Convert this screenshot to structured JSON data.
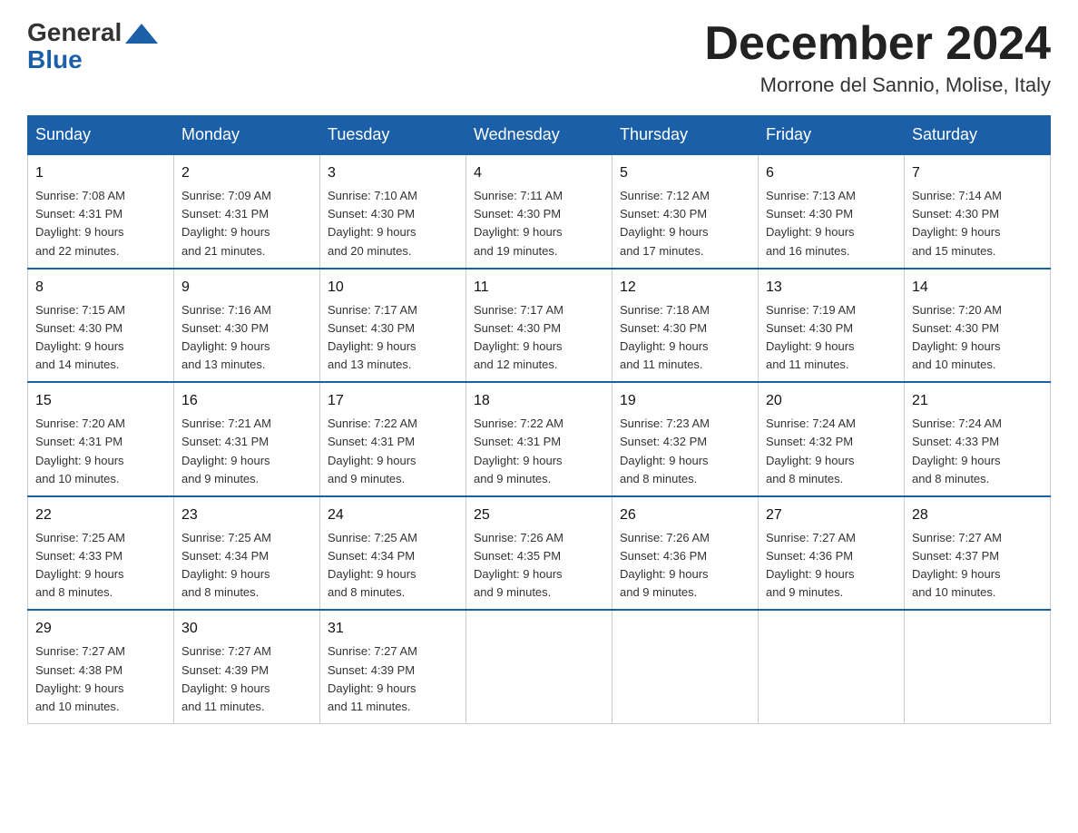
{
  "logo": {
    "general": "General",
    "blue": "Blue"
  },
  "title": "December 2024",
  "location": "Morrone del Sannio, Molise, Italy",
  "headers": [
    "Sunday",
    "Monday",
    "Tuesday",
    "Wednesday",
    "Thursday",
    "Friday",
    "Saturday"
  ],
  "weeks": [
    [
      {
        "day": "1",
        "sunrise": "7:08 AM",
        "sunset": "4:31 PM",
        "daylight": "9 hours and 22 minutes."
      },
      {
        "day": "2",
        "sunrise": "7:09 AM",
        "sunset": "4:31 PM",
        "daylight": "9 hours and 21 minutes."
      },
      {
        "day": "3",
        "sunrise": "7:10 AM",
        "sunset": "4:30 PM",
        "daylight": "9 hours and 20 minutes."
      },
      {
        "day": "4",
        "sunrise": "7:11 AM",
        "sunset": "4:30 PM",
        "daylight": "9 hours and 19 minutes."
      },
      {
        "day": "5",
        "sunrise": "7:12 AM",
        "sunset": "4:30 PM",
        "daylight": "9 hours and 17 minutes."
      },
      {
        "day": "6",
        "sunrise": "7:13 AM",
        "sunset": "4:30 PM",
        "daylight": "9 hours and 16 minutes."
      },
      {
        "day": "7",
        "sunrise": "7:14 AM",
        "sunset": "4:30 PM",
        "daylight": "9 hours and 15 minutes."
      }
    ],
    [
      {
        "day": "8",
        "sunrise": "7:15 AM",
        "sunset": "4:30 PM",
        "daylight": "9 hours and 14 minutes."
      },
      {
        "day": "9",
        "sunrise": "7:16 AM",
        "sunset": "4:30 PM",
        "daylight": "9 hours and 13 minutes."
      },
      {
        "day": "10",
        "sunrise": "7:17 AM",
        "sunset": "4:30 PM",
        "daylight": "9 hours and 13 minutes."
      },
      {
        "day": "11",
        "sunrise": "7:17 AM",
        "sunset": "4:30 PM",
        "daylight": "9 hours and 12 minutes."
      },
      {
        "day": "12",
        "sunrise": "7:18 AM",
        "sunset": "4:30 PM",
        "daylight": "9 hours and 11 minutes."
      },
      {
        "day": "13",
        "sunrise": "7:19 AM",
        "sunset": "4:30 PM",
        "daylight": "9 hours and 11 minutes."
      },
      {
        "day": "14",
        "sunrise": "7:20 AM",
        "sunset": "4:30 PM",
        "daylight": "9 hours and 10 minutes."
      }
    ],
    [
      {
        "day": "15",
        "sunrise": "7:20 AM",
        "sunset": "4:31 PM",
        "daylight": "9 hours and 10 minutes."
      },
      {
        "day": "16",
        "sunrise": "7:21 AM",
        "sunset": "4:31 PM",
        "daylight": "9 hours and 9 minutes."
      },
      {
        "day": "17",
        "sunrise": "7:22 AM",
        "sunset": "4:31 PM",
        "daylight": "9 hours and 9 minutes."
      },
      {
        "day": "18",
        "sunrise": "7:22 AM",
        "sunset": "4:31 PM",
        "daylight": "9 hours and 9 minutes."
      },
      {
        "day": "19",
        "sunrise": "7:23 AM",
        "sunset": "4:32 PM",
        "daylight": "9 hours and 8 minutes."
      },
      {
        "day": "20",
        "sunrise": "7:24 AM",
        "sunset": "4:32 PM",
        "daylight": "9 hours and 8 minutes."
      },
      {
        "day": "21",
        "sunrise": "7:24 AM",
        "sunset": "4:33 PM",
        "daylight": "9 hours and 8 minutes."
      }
    ],
    [
      {
        "day": "22",
        "sunrise": "7:25 AM",
        "sunset": "4:33 PM",
        "daylight": "9 hours and 8 minutes."
      },
      {
        "day": "23",
        "sunrise": "7:25 AM",
        "sunset": "4:34 PM",
        "daylight": "9 hours and 8 minutes."
      },
      {
        "day": "24",
        "sunrise": "7:25 AM",
        "sunset": "4:34 PM",
        "daylight": "9 hours and 8 minutes."
      },
      {
        "day": "25",
        "sunrise": "7:26 AM",
        "sunset": "4:35 PM",
        "daylight": "9 hours and 9 minutes."
      },
      {
        "day": "26",
        "sunrise": "7:26 AM",
        "sunset": "4:36 PM",
        "daylight": "9 hours and 9 minutes."
      },
      {
        "day": "27",
        "sunrise": "7:27 AM",
        "sunset": "4:36 PM",
        "daylight": "9 hours and 9 minutes."
      },
      {
        "day": "28",
        "sunrise": "7:27 AM",
        "sunset": "4:37 PM",
        "daylight": "9 hours and 10 minutes."
      }
    ],
    [
      {
        "day": "29",
        "sunrise": "7:27 AM",
        "sunset": "4:38 PM",
        "daylight": "9 hours and 10 minutes."
      },
      {
        "day": "30",
        "sunrise": "7:27 AM",
        "sunset": "4:39 PM",
        "daylight": "9 hours and 11 minutes."
      },
      {
        "day": "31",
        "sunrise": "7:27 AM",
        "sunset": "4:39 PM",
        "daylight": "9 hours and 11 minutes."
      },
      null,
      null,
      null,
      null
    ]
  ],
  "labels": {
    "sunrise": "Sunrise:",
    "sunset": "Sunset:",
    "daylight": "Daylight:"
  }
}
